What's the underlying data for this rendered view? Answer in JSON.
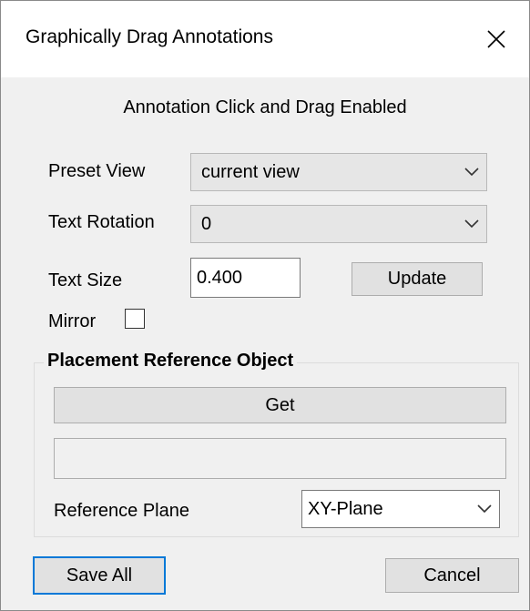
{
  "window": {
    "title": "Graphically Drag Annotations"
  },
  "status_text": "Annotation Click and Drag Enabled",
  "preset_view": {
    "label": "Preset View",
    "value": "current view"
  },
  "text_rotation": {
    "label": "Text Rotation",
    "value": "0"
  },
  "text_size": {
    "label": "Text Size",
    "value": "0.400"
  },
  "update_button": "Update",
  "mirror": {
    "label": "Mirror",
    "checked": false
  },
  "placement_group": {
    "title": "Placement Reference Object",
    "get_button": "Get",
    "object_field_value": "",
    "reference_plane": {
      "label": "Reference Plane",
      "value": "XY-Plane"
    }
  },
  "footer": {
    "save_all": "Save All",
    "cancel": "Cancel"
  },
  "colors": {
    "default_button_border": "#0078d7",
    "window_bg": "#f0f0f0",
    "titlebar_bg": "#ffffff"
  },
  "icons": {
    "close": "close-icon",
    "dropdown": "chevron-down-icon"
  }
}
